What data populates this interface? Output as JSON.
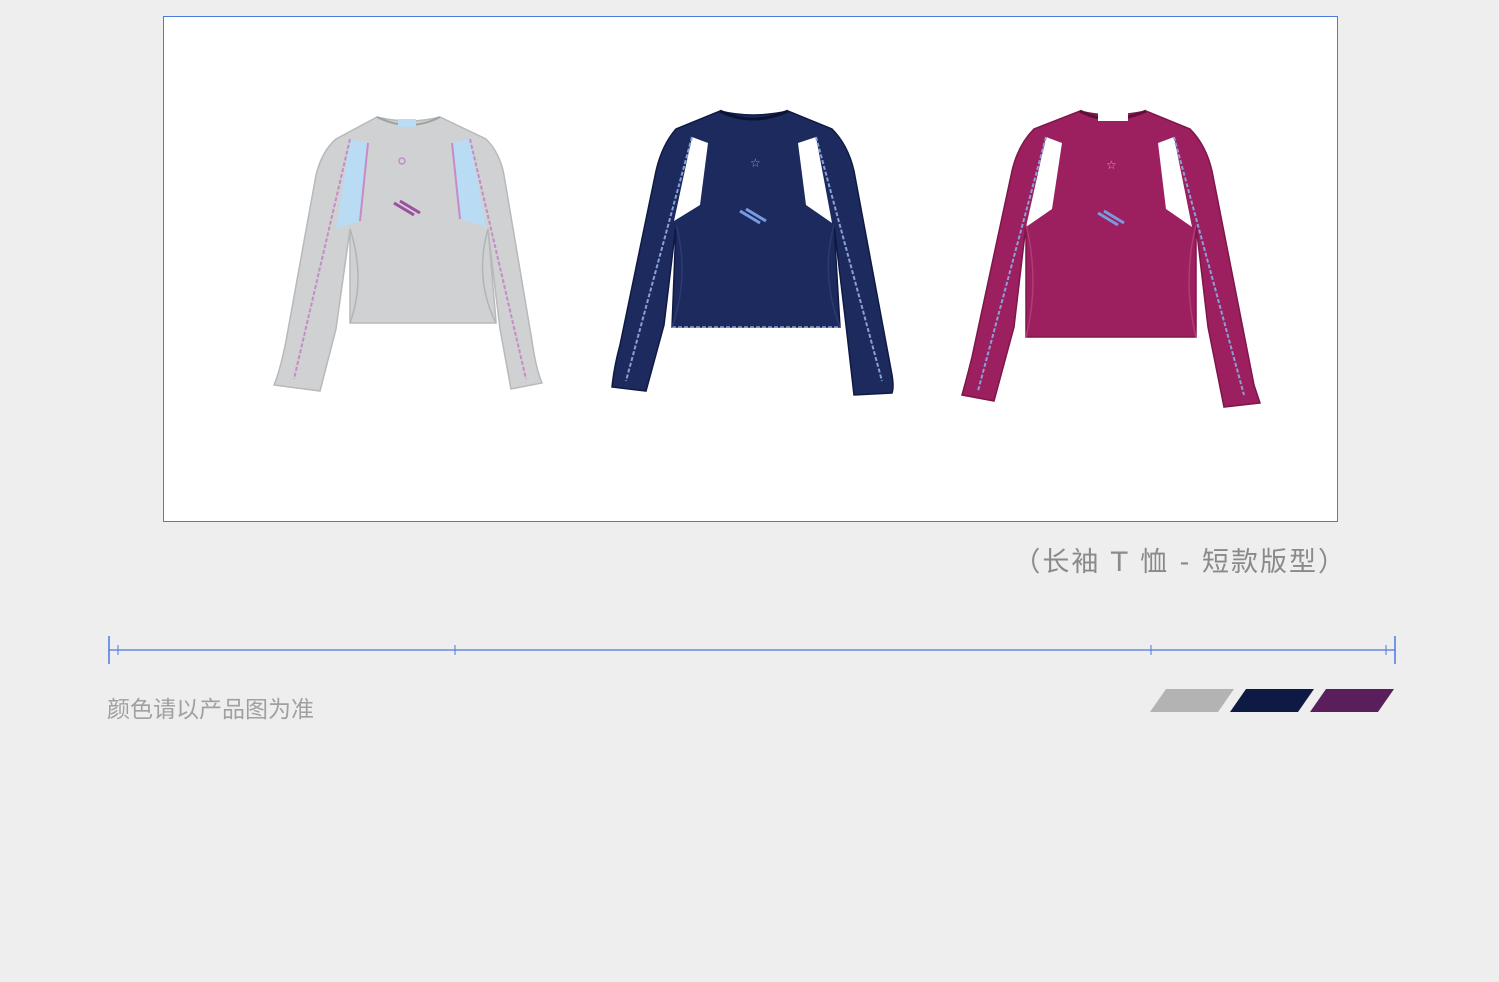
{
  "product": {
    "caption": "（长袖 T 恤 - 短款版型）",
    "variants": [
      {
        "name": "grey",
        "body_color": "#cfd1d2",
        "panel_color": "#b9dbf3",
        "stitch_color": "#c78bc6"
      },
      {
        "name": "navy",
        "body_color": "#1c2a5e",
        "panel_color": "#ffffff",
        "stitch_color": "#8aa0d8"
      },
      {
        "name": "magenta",
        "body_color": "#9c1f5f",
        "panel_color": "#ffffff",
        "stitch_color": "#8aa0d8"
      }
    ]
  },
  "notice": {
    "color_disclaimer": "颜色请以产品图为准"
  },
  "swatches": [
    {
      "name": "grey-swatch",
      "color": "#b3b3b3"
    },
    {
      "name": "navy-swatch",
      "color": "#0e1a43"
    },
    {
      "name": "purple-swatch",
      "color": "#5b1e5d"
    }
  ]
}
